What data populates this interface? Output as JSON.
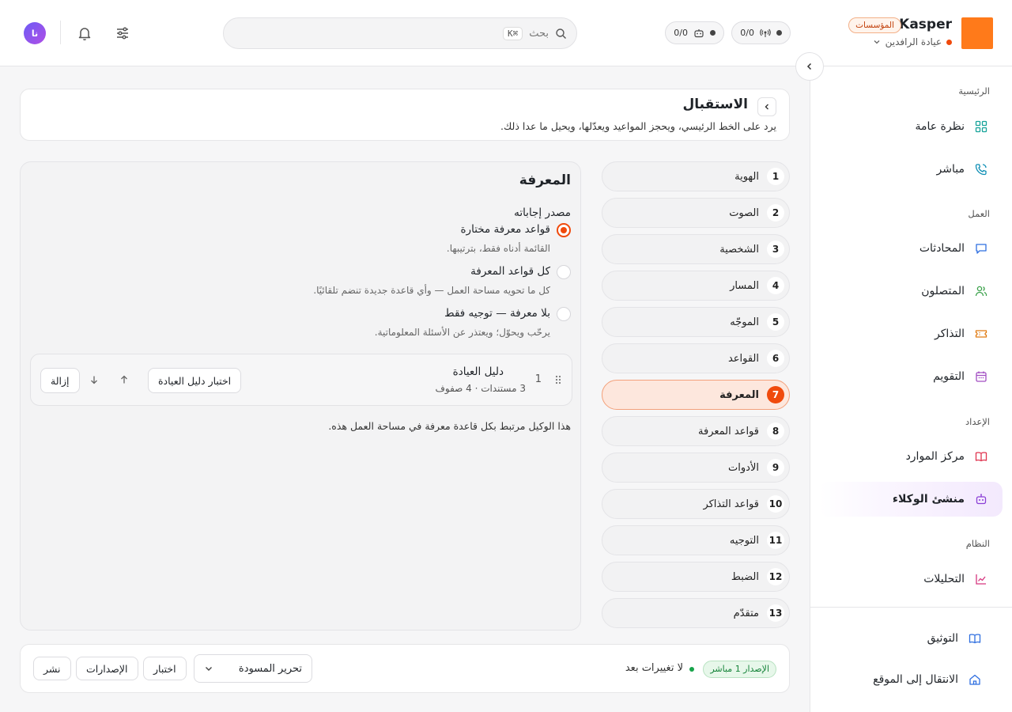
{
  "header": {
    "brand_name": "Kasper",
    "brand_badge": "المؤسسات",
    "org_name": "عيادة الرافدين",
    "chip_calls": "0/0",
    "chip_agents": "0/0",
    "search_placeholder": "بحث",
    "search_shortcut": "⌘K",
    "avatar_initials": "نا"
  },
  "sidebar": {
    "sections": {
      "home": "الرئيسية",
      "work": "العمل",
      "setup": "الإعداد",
      "system": "النظام"
    },
    "items": {
      "overview": "نظرة عامة",
      "live": "مباشر",
      "conversations": "المحادثات",
      "callers": "المتصلون",
      "tickets": "التذاكر",
      "calendar": "التقويم",
      "resources": "مركز الموارد",
      "agent_builder": "منشئ الوكلاء",
      "analytics": "التحليلات",
      "docs": "التوثيق",
      "goto_site": "الانتقال إلى الموقع"
    }
  },
  "agent": {
    "title": "الاستقبال",
    "description": "يرد على الخط الرئيسي، ويحجز المواعيد ويعدّلها، ويحيل ما عدا ذلك."
  },
  "steps": [
    {
      "num": "1",
      "label": "الهوية"
    },
    {
      "num": "2",
      "label": "الصوت"
    },
    {
      "num": "3",
      "label": "الشخصية"
    },
    {
      "num": "4",
      "label": "المسار"
    },
    {
      "num": "5",
      "label": "الموجّه"
    },
    {
      "num": "6",
      "label": "القواعد"
    },
    {
      "num": "7",
      "label": "المعرفة"
    },
    {
      "num": "8",
      "label": "قواعد المعرفة"
    },
    {
      "num": "9",
      "label": "الأدوات"
    },
    {
      "num": "10",
      "label": "قواعد التذاكر"
    },
    {
      "num": "11",
      "label": "التوجيه"
    },
    {
      "num": "12",
      "label": "الضبط"
    },
    {
      "num": "13",
      "label": "متقدّم"
    }
  ],
  "knowledge": {
    "title": "المعرفة",
    "source_label": "مصدر إجاباته",
    "options": [
      {
        "label": "قواعد معرفة مختارة",
        "desc": "القائمة أدناه فقط، بترتيبها.",
        "selected": true
      },
      {
        "label": "كل قواعد المعرفة",
        "desc": "كل ما تحويه مساحة العمل — وأي قاعدة جديدة تنضم تلقائيًا.",
        "selected": false
      },
      {
        "label": "بلا معرفة — توجيه فقط",
        "desc": "يرحّب ويحوّل؛ ويعتذر عن الأسئلة المعلوماتية.",
        "selected": false
      }
    ],
    "kb": {
      "index": "1",
      "name": "دليل العيادة",
      "meta": "3 مستندات · 4 صفوف",
      "test_button": "اختبار دليل العيادة",
      "remove_button": "إزالة"
    },
    "note": "هذا الوكيل مرتبط بكل قاعدة معرفة في مساحة العمل هذه."
  },
  "footer": {
    "version_badge": "الإصدار 1 مباشر",
    "status": "لا تغييرات بعد",
    "select_value": "تحرير المسودة",
    "test_button": "اختبار",
    "versions_button": "الإصدارات",
    "publish_button": "نشر"
  }
}
